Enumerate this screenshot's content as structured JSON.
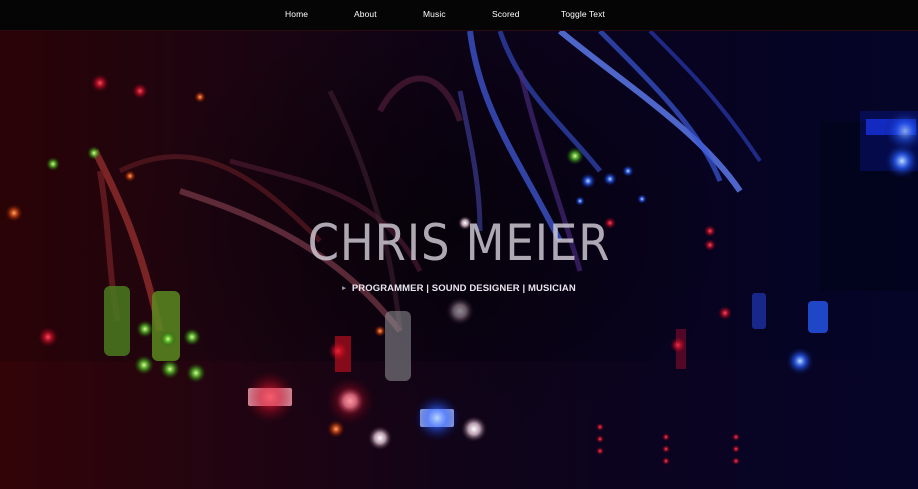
{
  "nav": {
    "items": [
      {
        "label": "Home"
      },
      {
        "label": "About"
      },
      {
        "label": "Music"
      },
      {
        "label": "Scored"
      },
      {
        "label": "Toggle Text"
      }
    ]
  },
  "hero": {
    "title": "CHRIS MEIER",
    "subtitle": "PROGRAMMER | SOUND DESIGNER | MUSICIAN",
    "background_image": "modular-synth-cables-photo",
    "colors": {
      "left_tint": "#2a0307",
      "right_tint": "#050528",
      "title": "#d2cdd7",
      "subtitle": "#e8e6ee"
    }
  },
  "colors": {
    "navbar_bg": "#050506",
    "nav_text": "#ffffff"
  }
}
